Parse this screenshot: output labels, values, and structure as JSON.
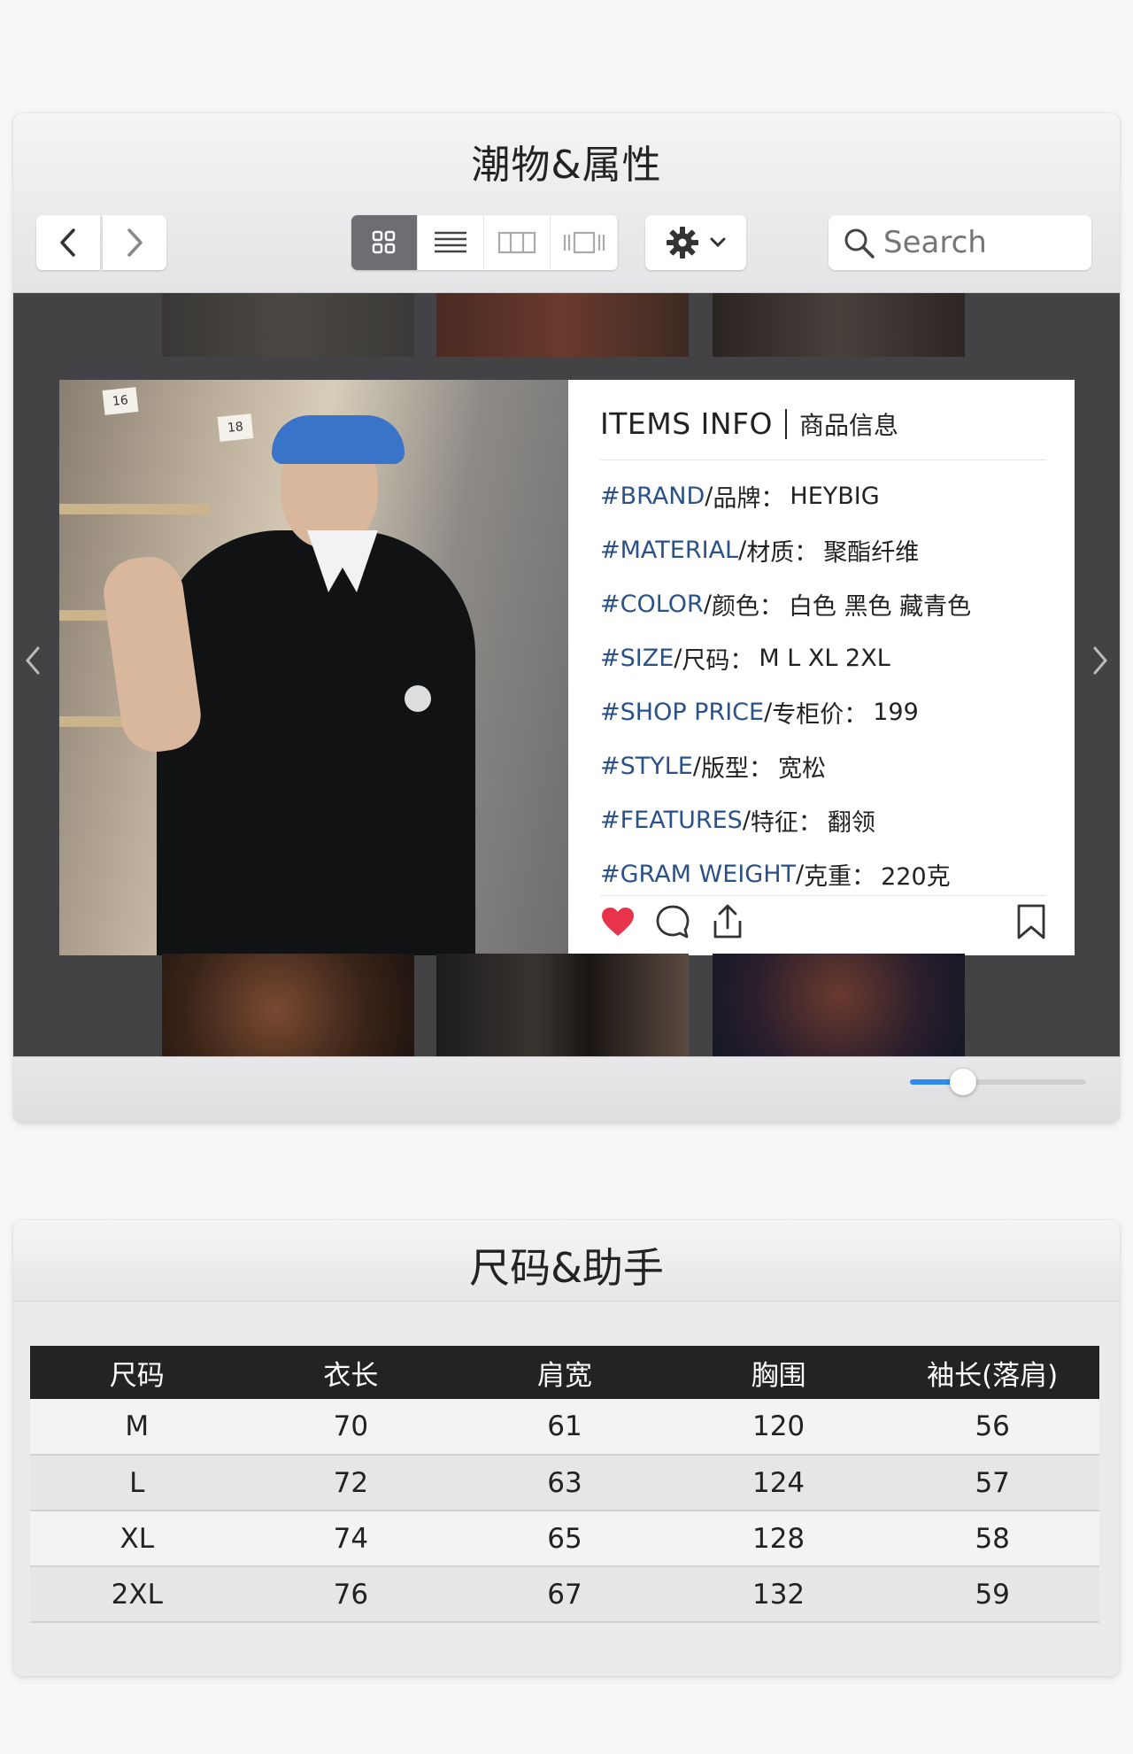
{
  "window1": {
    "title": "潮物&属性",
    "search": {
      "placeholder": "Search"
    },
    "card": {
      "photo_tags": [
        "16",
        "18"
      ],
      "info_title_en": "ITEMS INFO",
      "info_title_zh": "商品信息",
      "rows": [
        {
          "key": "#BRAND",
          "key_zh": "品牌：",
          "value": "HEYBIG"
        },
        {
          "key": "#MATERIAL",
          "key_zh": "材质：",
          "value": "聚酯纤维"
        },
        {
          "key": "#COLOR",
          "key_zh": "颜色：",
          "value": "白色 黑色 藏青色"
        },
        {
          "key": "#SIZE",
          "key_zh": "尺码：",
          "value": "M L XL 2XL"
        },
        {
          "key": "#SHOP PRICE",
          "key_zh": "专柜价：",
          "value": "199"
        },
        {
          "key": "#STYLE",
          "key_zh": "版型：",
          "value": "宽松"
        },
        {
          "key": "#FEATURES",
          "key_zh": "特征：",
          "value": "翻领"
        },
        {
          "key": "#GRAM WEIGHT",
          "key_zh": "克重：",
          "value": "220克"
        }
      ]
    },
    "zoom_level": 0.3,
    "colors": {
      "like": "#e8344a",
      "key_text": "#2a5288",
      "slider": "#2f8bf0"
    }
  },
  "window2": {
    "title": "尺码&助手",
    "table": {
      "headers": [
        "尺码",
        "衣长",
        "肩宽",
        "胸围",
        "袖长(落肩)"
      ],
      "rows": [
        [
          "M",
          "70",
          "61",
          "120",
          "56"
        ],
        [
          "L",
          "72",
          "63",
          "124",
          "57"
        ],
        [
          "XL",
          "74",
          "65",
          "128",
          "58"
        ],
        [
          "2XL",
          "76",
          "67",
          "132",
          "59"
        ]
      ]
    }
  }
}
